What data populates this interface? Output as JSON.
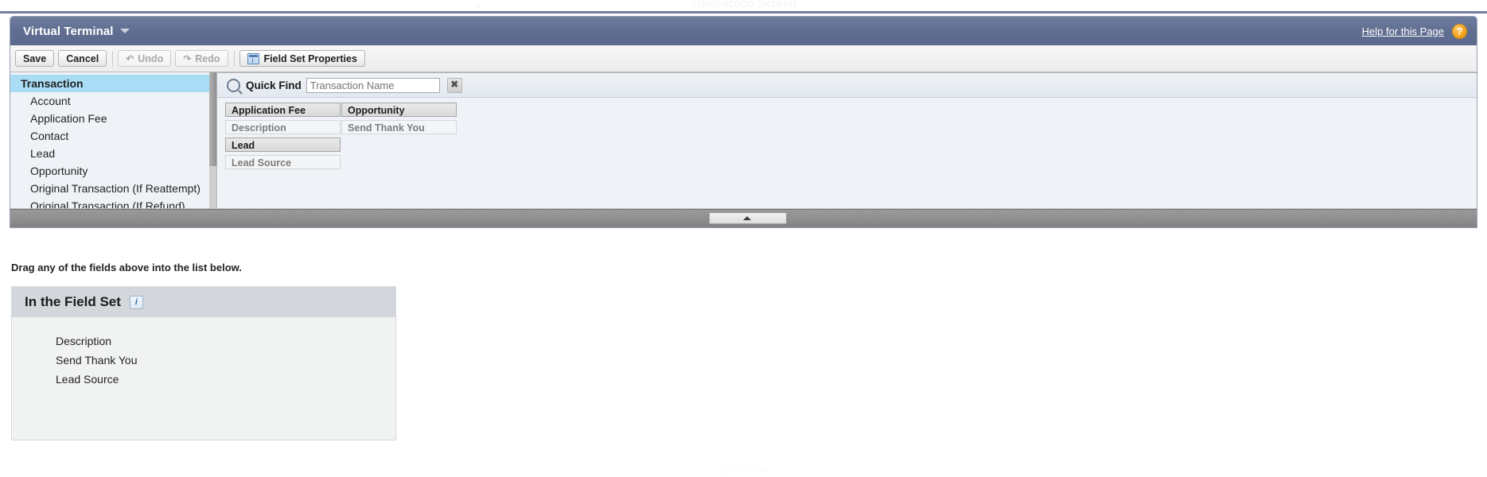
{
  "ghost": {
    "top_text": "Transaction Screen",
    "bottom_text": "Quick Start",
    "chevron": "›"
  },
  "header": {
    "title": "Virtual Terminal",
    "caret_icon": "chevron-down",
    "help_link": "Help for this Page",
    "help_badge": "?"
  },
  "toolbar": {
    "save_label": "Save",
    "cancel_label": "Cancel",
    "undo_label": "Undo",
    "undo_glyph": "↶",
    "redo_label": "Redo",
    "redo_glyph": "↷",
    "field_set_properties_label": "Field Set Properties"
  },
  "object_list": {
    "items": [
      {
        "label": "Transaction",
        "selected": true
      },
      {
        "label": "Account",
        "selected": false
      },
      {
        "label": "Application Fee",
        "selected": false
      },
      {
        "label": "Contact",
        "selected": false
      },
      {
        "label": "Lead",
        "selected": false
      },
      {
        "label": "Opportunity",
        "selected": false
      },
      {
        "label": "Original Transaction (If Reattempt)",
        "selected": false
      },
      {
        "label": "Original Transaction (If Refund)",
        "selected": false
      }
    ]
  },
  "quick_find": {
    "icon": "search-icon",
    "label": "Quick Find",
    "value": "",
    "placeholder": "Transaction Name",
    "clear_label": "✖"
  },
  "palette": {
    "columns": [
      {
        "group": "Application Fee",
        "fields": [
          "Description"
        ],
        "group2": "Lead",
        "fields2": [
          "Lead Source"
        ]
      },
      {
        "group": "Opportunity",
        "fields": [
          "Send Thank You"
        ]
      }
    ],
    "col1_group1": "Application Fee",
    "col1_field1": "Description",
    "col1_group2": "Lead",
    "col1_field2": "Lead Source",
    "col2_group1": "Opportunity",
    "col2_field1": "Send Thank You"
  },
  "drag_hint": "Drag any of the fields above into the list below.",
  "field_set": {
    "title": "In the Field Set",
    "info_icon": "i",
    "items": [
      "Description",
      "Send Thank You",
      "Lead Source"
    ]
  },
  "colors": {
    "titlebar": "#606e91",
    "selected_row": "#a9dcf5",
    "panel_bg": "#eff3f7",
    "fieldset_head": "#d3d6da",
    "help_badge": "#f0a01c"
  }
}
